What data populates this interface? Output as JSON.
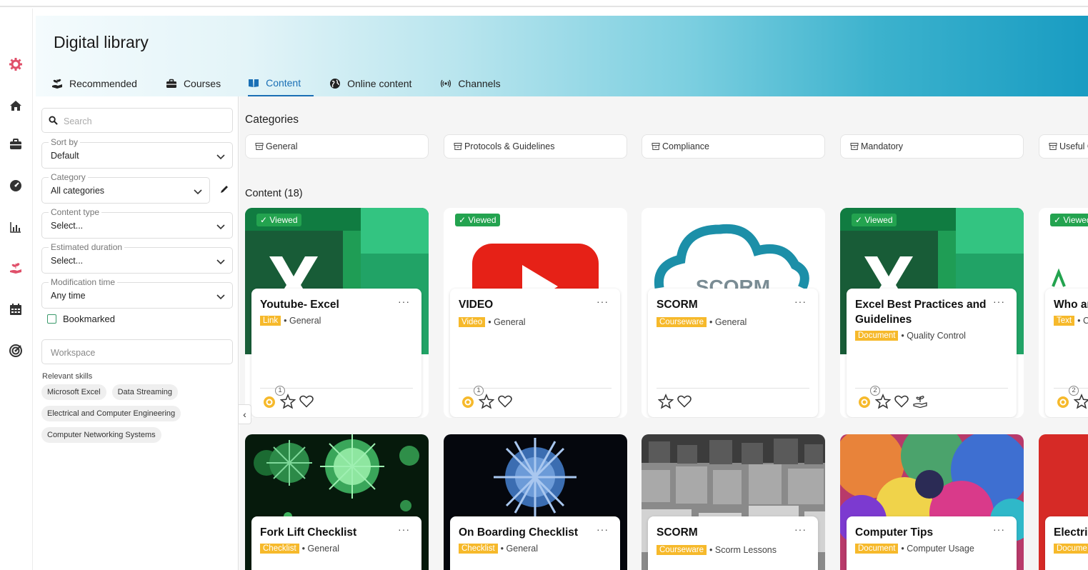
{
  "page": {
    "title": "Digital library"
  },
  "tabs": [
    {
      "label": "Recommended",
      "icon": "hand-plant-icon"
    },
    {
      "label": "Courses",
      "icon": "briefcase-icon"
    },
    {
      "label": "Content",
      "icon": "book-icon",
      "active": true
    },
    {
      "label": "Online content",
      "icon": "globe-icon"
    },
    {
      "label": "Channels",
      "icon": "broadcast-icon"
    }
  ],
  "rail": [
    "gear-icon",
    "home-icon",
    "briefcase-icon",
    "dashboard-icon",
    "bar-chart-icon",
    "hand-plant-icon",
    "calendar-icon",
    "target-icon"
  ],
  "filters": {
    "search_placeholder": "Search",
    "sort": {
      "label": "Sort by",
      "value": "Default"
    },
    "category": {
      "label": "Category",
      "value": "All categories"
    },
    "content_type": {
      "label": "Content type",
      "value": "Select..."
    },
    "duration": {
      "label": "Estimated duration",
      "value": "Select..."
    },
    "modification": {
      "label": "Modification time",
      "value": "Any time"
    },
    "bookmarked": "Bookmarked",
    "workspace_placeholder": "Workspace",
    "skills_title": "Relevant skills",
    "skills": [
      "Microsoft Excel",
      "Data Streaming",
      "Electrical and Computer Engineering",
      "Computer Networking Systems"
    ]
  },
  "categories": {
    "title": "Categories",
    "items": [
      "General",
      "Protocols & Guidelines",
      "Compliance",
      "Mandatory",
      "Useful G"
    ]
  },
  "content": {
    "title": "Content (18)",
    "viewed_label": "Viewed",
    "row1": [
      {
        "title": "Youtube- Excel",
        "type": "Link",
        "category": "General",
        "viewed": true,
        "views": "1"
      },
      {
        "title": "VIDEO",
        "type": "Video",
        "category": "General",
        "viewed": true,
        "views": "1"
      },
      {
        "title": "SCORM",
        "type": "Courseware",
        "category": "General",
        "viewed": false
      },
      {
        "title": "Excel Best Practices and Guidelines",
        "type": "Document",
        "category": "Quality Control",
        "viewed": true,
        "views": "2"
      },
      {
        "title": "Who ar",
        "type": "Text",
        "category": "C",
        "viewed": true,
        "views": "2"
      }
    ],
    "row2": [
      {
        "title": "Fork Lift Checklist",
        "type": "Checklist",
        "category": "General"
      },
      {
        "title": "On Boarding Checklist",
        "type": "Checklist",
        "category": "General"
      },
      {
        "title": "SCORM",
        "type": "Courseware",
        "category": "Scorm Lessons"
      },
      {
        "title": "Computer Tips",
        "type": "Document",
        "category": "Computer Usage"
      },
      {
        "title": "Electri",
        "type": "Docume",
        "category": ""
      }
    ]
  },
  "colors": {
    "accent": "#1a6fb5",
    "badge": "#f6b92b",
    "viewed": "#23a34f",
    "view_eye": "#f6b92b"
  }
}
